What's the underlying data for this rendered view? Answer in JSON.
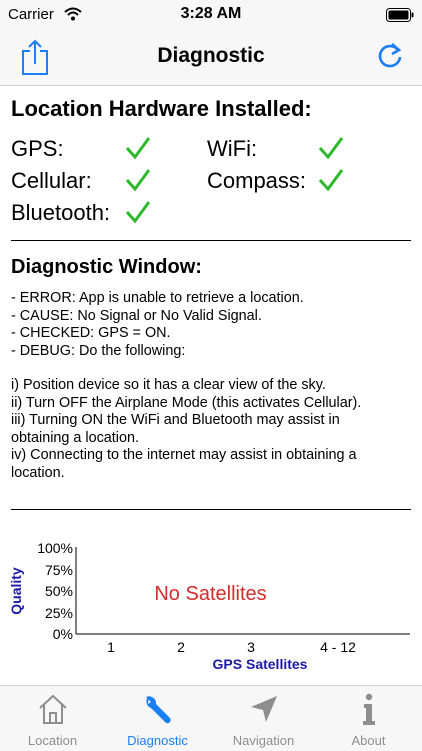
{
  "status_bar": {
    "carrier": "Carrier",
    "time": "3:28 AM"
  },
  "nav": {
    "title": "Diagnostic",
    "left_icon": "share-icon",
    "right_icon": "refresh-icon"
  },
  "hardware": {
    "title": "Location Hardware Installed:",
    "items": [
      {
        "label": "GPS:",
        "installed": true
      },
      {
        "label": "WiFi:",
        "installed": true
      },
      {
        "label": "Cellular:",
        "installed": true
      },
      {
        "label": "Compass:",
        "installed": true
      },
      {
        "label": "Bluetooth:",
        "installed": true
      }
    ]
  },
  "diagnostic": {
    "title": "Diagnostic Window:",
    "lines": [
      "- ERROR: App is unable to retrieve a location.",
      "- CAUSE: No Signal or No Valid Signal.",
      "- CHECKED: GPS = ON.",
      "- DEBUG: Do the following:",
      "i) Position device so it has a clear view of the sky.",
      "ii) Turn OFF the Airplane Mode (this activates Cellular).",
      "iii) Turning ON the WiFi and Bluetooth may assist in",
      "obtaining a location.",
      "iv) Connecting to the internet may assist in obtaining a",
      "location."
    ]
  },
  "chart_data": {
    "type": "bar",
    "categories": [
      "1",
      "2",
      "3",
      "4 - 12"
    ],
    "values": [],
    "xlabel": "GPS Satellites",
    "ylabel": "Quality",
    "yticks": [
      "100%",
      "75%",
      "50%",
      "25%",
      "0%"
    ],
    "ylim": [
      0,
      100
    ],
    "grid": false,
    "annotation": "No Satellites"
  },
  "tabs": [
    {
      "label": "Location",
      "icon": "house-icon",
      "active": false
    },
    {
      "label": "Diagnostic",
      "icon": "wrench-icon",
      "active": true
    },
    {
      "label": "Navigation",
      "icon": "navigation-arrow-icon",
      "active": false
    },
    {
      "label": "About",
      "icon": "info-icon",
      "active": false
    }
  ],
  "colors": {
    "accent": "#1a7ef5",
    "check": "#2db82d",
    "warning": "#d42b2b",
    "axis_title": "#1a1aa6",
    "inactive_tab": "#8e8e8e"
  }
}
